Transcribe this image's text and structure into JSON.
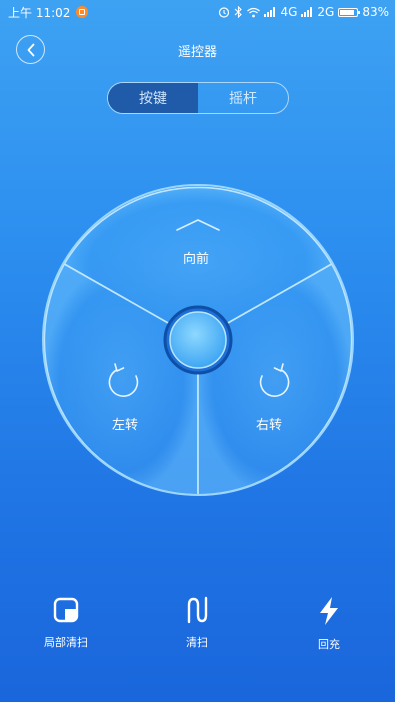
{
  "status_bar": {
    "time": "上午 11:02",
    "network": "4G",
    "network2": "2G",
    "battery": "83%"
  },
  "header": {
    "title": "遥控器"
  },
  "tabs": [
    {
      "label": "按键",
      "active": true
    },
    {
      "label": "摇杆",
      "active": false
    }
  ],
  "pad": {
    "forward_label": "向前",
    "left_label": "左转",
    "right_label": "右转"
  },
  "bottom_actions": [
    {
      "label": "局部清扫",
      "icon": "spot-clean-icon"
    },
    {
      "label": "清扫",
      "icon": "clean-icon"
    },
    {
      "label": "回充",
      "icon": "recharge-icon"
    }
  ],
  "colors": {
    "background_top": "#3ea2f3",
    "background_bottom": "#1a66dc",
    "active_tab": "#1f5ba8"
  }
}
